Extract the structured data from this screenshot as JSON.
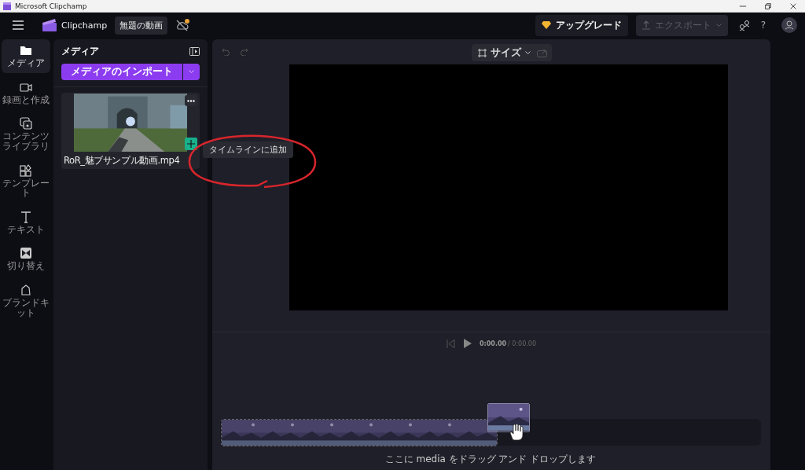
{
  "window": {
    "title": "Microsoft Clipchamp"
  },
  "header": {
    "app_name": "Clipchamp",
    "project_title": "無題の動画",
    "upgrade_label": "アップグレード",
    "export_label": "エクスポート",
    "export_disabled": true,
    "help_label": "?"
  },
  "sidebar": {
    "items": [
      {
        "label": "メディア",
        "selected": true
      },
      {
        "label": "録画と作成",
        "selected": false
      },
      {
        "label": "コンテンツライブラリ",
        "selected": false
      },
      {
        "label": "テンプレート",
        "selected": false
      },
      {
        "label": "テキスト",
        "selected": false
      },
      {
        "label": "切り替え",
        "selected": false
      },
      {
        "label": "ブランドキット",
        "selected": false
      }
    ]
  },
  "media_panel": {
    "title": "メディア",
    "import_label": "メディアのインポート",
    "items": [
      {
        "name": "RoR_魅ブサンプル動画.mp4",
        "kind": "picture",
        "tooltip": "タイムラインに追加"
      }
    ]
  },
  "preview": {
    "size_label": "サイズ",
    "current_time": "0:00.00",
    "total_time": "/ 0:00.00"
  },
  "timeline": {
    "drop_hint": "ここに media をドラッグ アンド ドロップします"
  }
}
